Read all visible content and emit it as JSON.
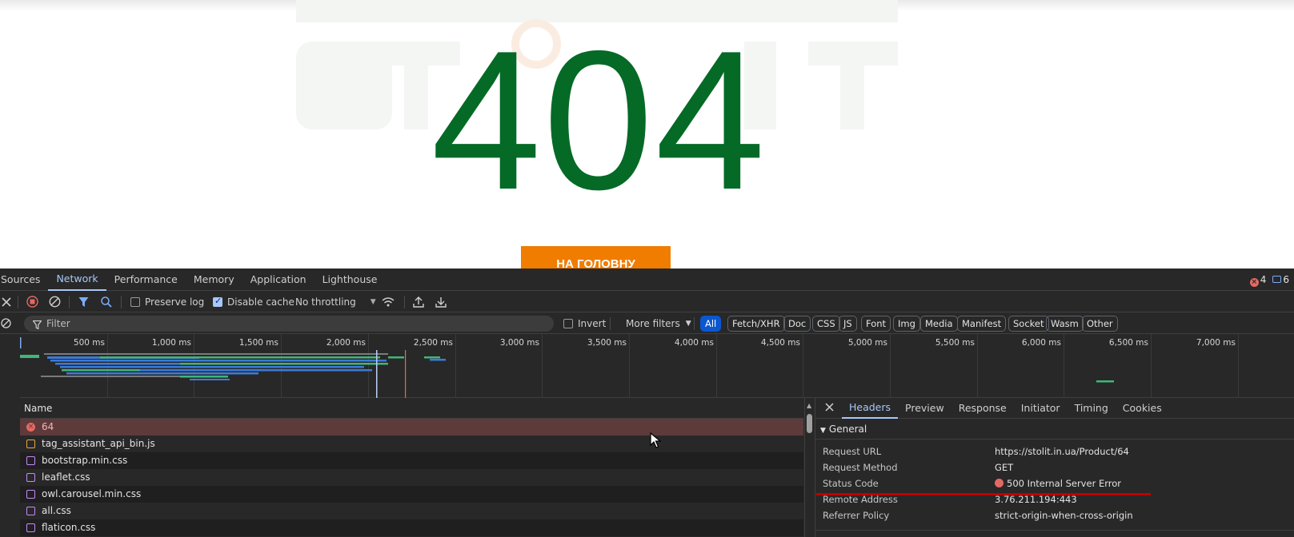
{
  "page": {
    "error_code": "404",
    "home_button": "НА ГОЛОВНУ"
  },
  "devtools": {
    "panel_tabs": [
      "Sources",
      "Network",
      "Performance",
      "Memory",
      "Application",
      "Lighthouse"
    ],
    "active_panel": "Network",
    "counters": {
      "errors": "4",
      "messages": "6"
    },
    "toolbar": {
      "preserve_log": "Preserve log",
      "disable_cache": "Disable cache",
      "throttling": "No throttling"
    },
    "filter": {
      "placeholder": "Filter",
      "invert": "Invert",
      "more_filters": "More filters",
      "types": [
        "All",
        "Fetch/XHR",
        "Doc",
        "CSS",
        "JS",
        "Font",
        "Img",
        "Media",
        "Manifest",
        "Socket",
        "Wasm",
        "Other"
      ],
      "active_type": "All"
    },
    "overview_ticks": [
      "500 ms",
      "1,000 ms",
      "1,500 ms",
      "2,000 ms",
      "2,500 ms",
      "3,000 ms",
      "3,500 ms",
      "4,000 ms",
      "4,500 ms",
      "5,000 ms",
      "5,500 ms",
      "6,000 ms",
      "6,500 ms",
      "7,000 ms"
    ],
    "requests": {
      "column_name": "Name",
      "rows": [
        {
          "name": "64",
          "type": "err"
        },
        {
          "name": "tag_assistant_api_bin.js",
          "type": "js"
        },
        {
          "name": "bootstrap.min.css",
          "type": "css"
        },
        {
          "name": "leaflet.css",
          "type": "css"
        },
        {
          "name": "owl.carousel.min.css",
          "type": "css"
        },
        {
          "name": "all.css",
          "type": "css"
        },
        {
          "name": "flaticon.css",
          "type": "css"
        }
      ]
    },
    "details": {
      "tabs": [
        "Headers",
        "Preview",
        "Response",
        "Initiator",
        "Timing",
        "Cookies"
      ],
      "active_tab": "Headers",
      "section": "General",
      "general": {
        "request_url_label": "Request URL",
        "request_url": "https://stolit.in.ua/Product/64",
        "request_method_label": "Request Method",
        "request_method": "GET",
        "status_code_label": "Status Code",
        "status_code": "500 Internal Server Error",
        "remote_address_label": "Remote Address",
        "remote_address": "3.76.211.194:443",
        "referrer_policy_label": "Referrer Policy",
        "referrer_policy": "strict-origin-when-cross-origin"
      }
    }
  },
  "colors": {
    "brand_green": "#046a26",
    "brand_orange": "#f07c00",
    "devtools_accent": "#a8c7fa",
    "error_red": "#e46962",
    "annotation_red": "#c00000"
  },
  "icons": [
    "close-icon",
    "record-stop-icon",
    "clear-icon",
    "filter-icon",
    "search-icon",
    "network-conditions-icon",
    "upload-icon",
    "download-icon",
    "error-icon",
    "message-icon",
    "cursor-icon"
  ]
}
